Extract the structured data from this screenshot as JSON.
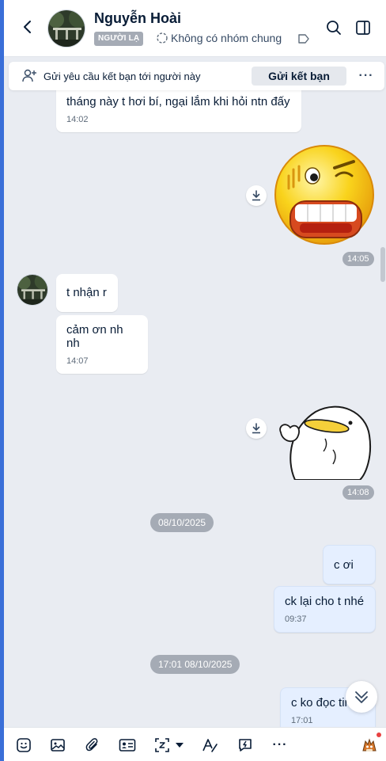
{
  "header": {
    "contact_name": "Nguyễn Hoài",
    "stranger_badge": "NGƯỜI LẠ",
    "group_info": "Không có nhóm chung",
    "icons": [
      "back-arrow-icon",
      "search-icon",
      "side-panel-icon",
      "tag-icon",
      "group-icon"
    ]
  },
  "friend_request": {
    "text": "Gửi yêu cầu kết bạn tới người này",
    "button_label": "Gửi kết bạn",
    "more_label": "···"
  },
  "messages": [
    {
      "from": "other",
      "text": "tháng này t hơi bí, ngại lắm khi hỏi ntn đấy",
      "time": "14:02"
    },
    {
      "from": "me",
      "type": "sticker",
      "sticker": "angry-teeth-emoji-sticker",
      "time": "14:05"
    },
    {
      "from": "other",
      "text": "t nhận r"
    },
    {
      "from": "other",
      "text": "cảm ơn nh nh",
      "time": "14:07"
    },
    {
      "from": "me",
      "type": "sticker",
      "sticker": "white-blob-thinking-sticker",
      "time": "14:08"
    },
    {
      "type": "date",
      "text": "08/10/2025"
    },
    {
      "from": "me",
      "text": "c ơi"
    },
    {
      "from": "me",
      "text": "ck lại cho t nhé",
      "time": "09:37"
    },
    {
      "type": "date",
      "text": "17:01 08/10/2025"
    },
    {
      "from": "me",
      "text": "c ko đọc tin",
      "time": "17:01"
    }
  ],
  "toolbar": {
    "icons": [
      "sticker-icon",
      "image-icon",
      "attachment-icon",
      "contact-card-icon",
      "screenshot-icon",
      "dropdown-icon",
      "text-format-icon",
      "quick-message-icon",
      "more-icon",
      "avatar-mascot-icon"
    ],
    "more_label": "···"
  },
  "colors": {
    "accent": "#3a6fd8",
    "my_bubble": "#e5efff",
    "background": "#e9ecf2",
    "pill": "#a5abb5"
  }
}
